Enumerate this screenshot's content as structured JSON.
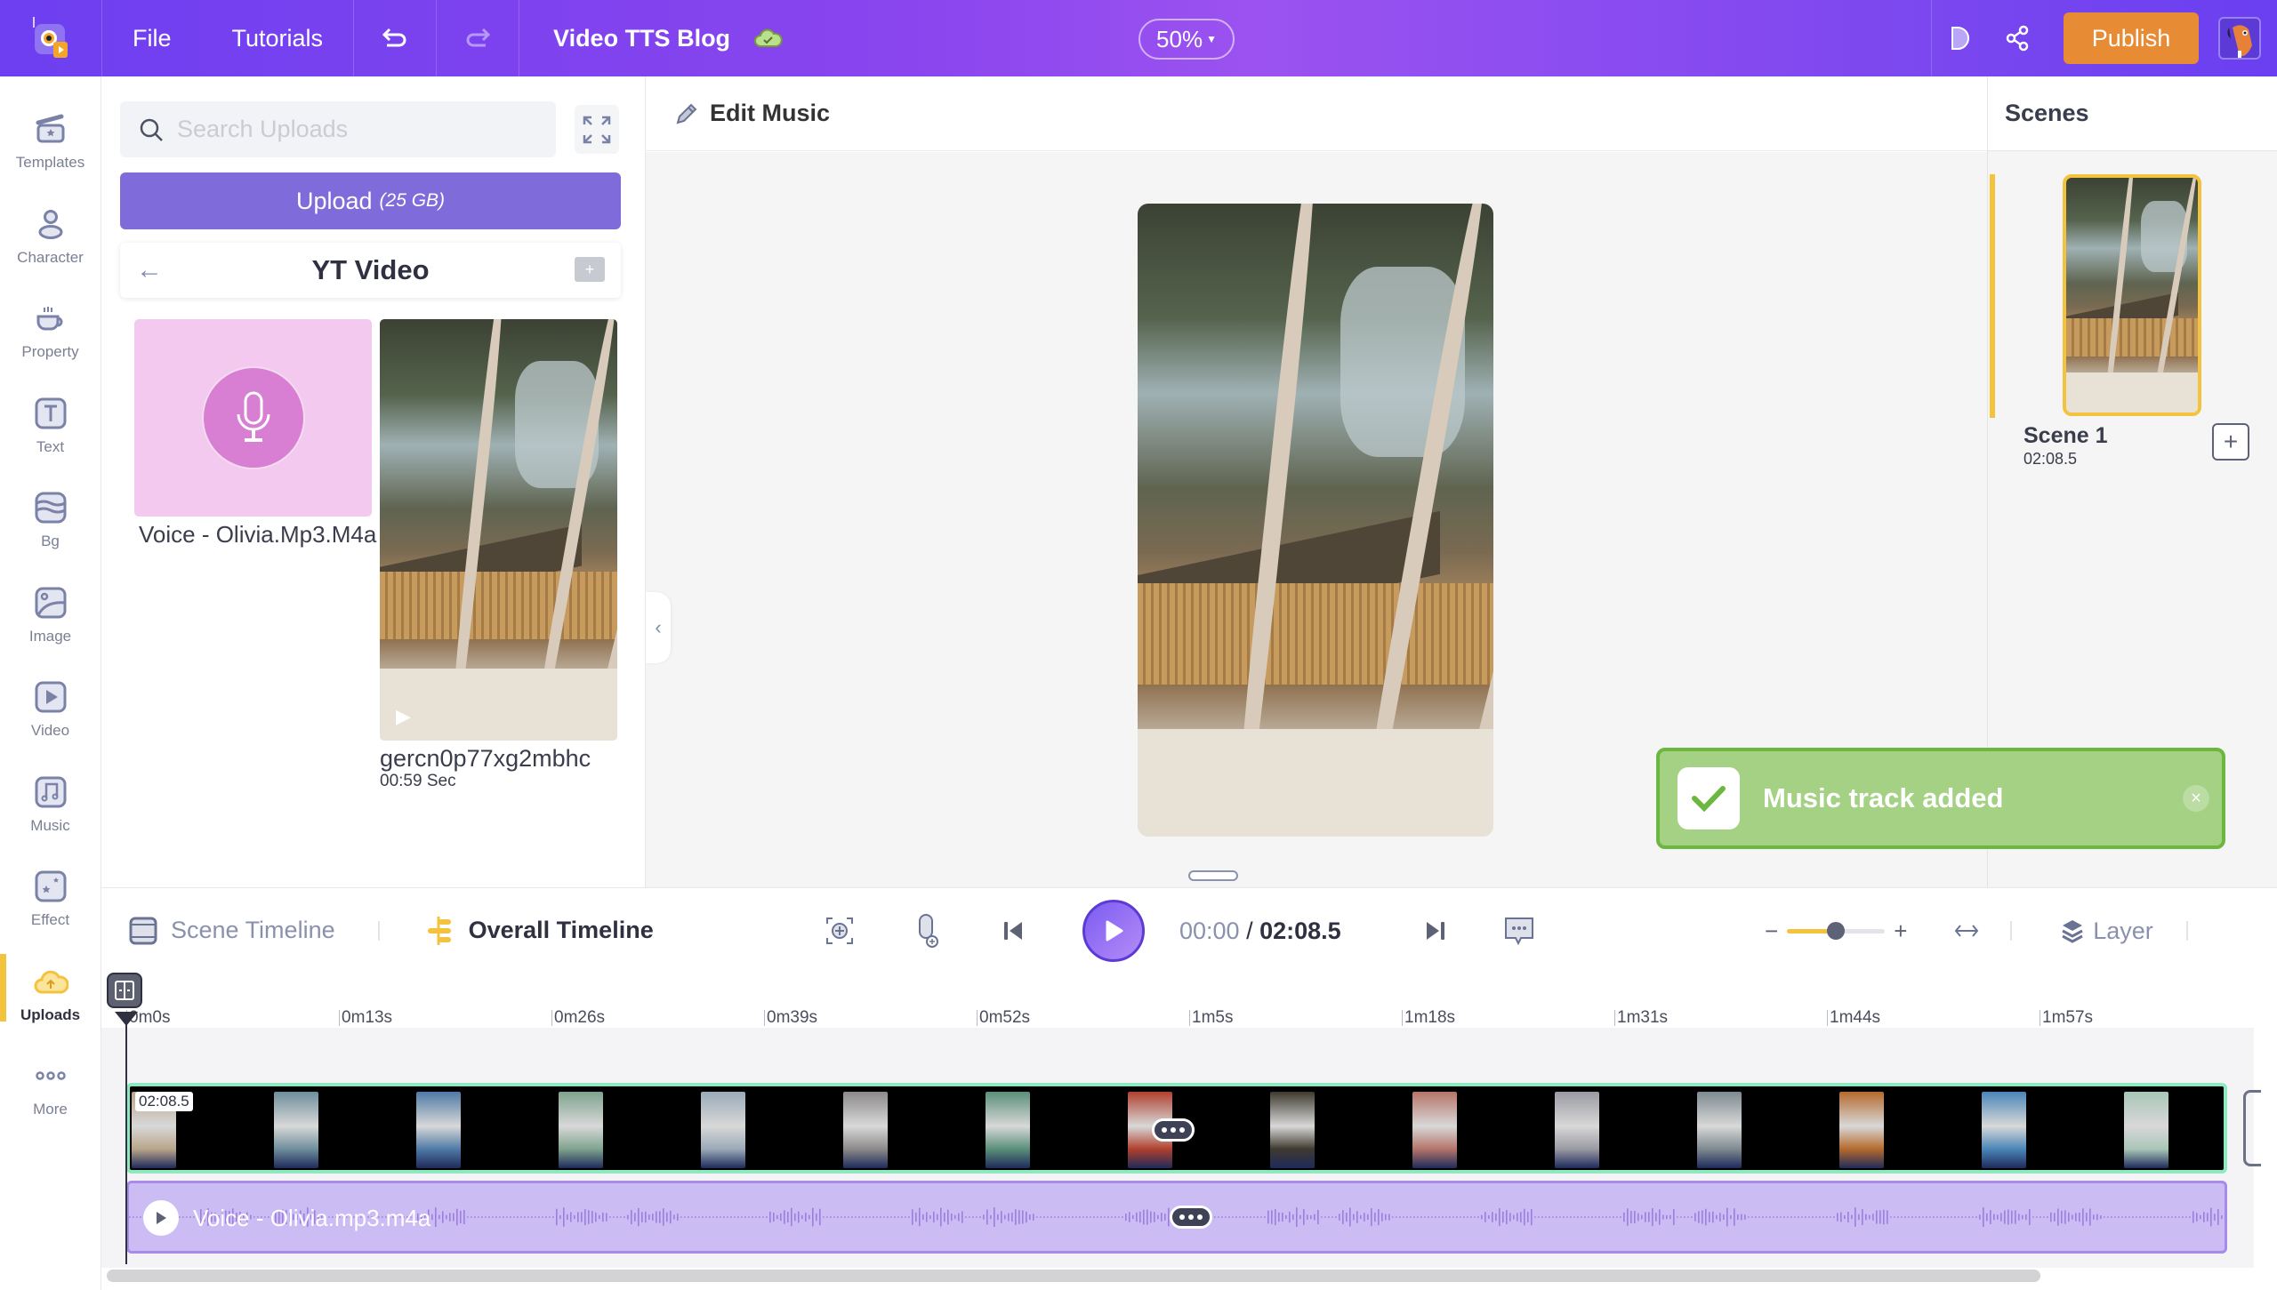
{
  "topbar": {
    "menu": [
      "File",
      "Tutorials"
    ],
    "project_title": "Video TTS Blog",
    "zoom_level": "50%",
    "publish_label": "Publish",
    "icons": {
      "logo": "app-logo",
      "undo": "undo-icon",
      "redo": "redo-icon",
      "cloud": "cloud-saved-icon",
      "preview": "play-preview-icon",
      "share": "share-icon"
    }
  },
  "sidebar": {
    "items": [
      {
        "label": "Templates",
        "icon": "clapperboard-icon",
        "active": false
      },
      {
        "label": "Character",
        "icon": "person-icon",
        "active": false
      },
      {
        "label": "Property",
        "icon": "cup-icon",
        "active": false
      },
      {
        "label": "Text",
        "icon": "text-icon",
        "active": false
      },
      {
        "label": "Bg",
        "icon": "layers-icon",
        "active": false
      },
      {
        "label": "Image",
        "icon": "image-icon",
        "active": false
      },
      {
        "label": "Video",
        "icon": "video-icon",
        "active": false
      },
      {
        "label": "Music",
        "icon": "music-note-icon",
        "active": false
      },
      {
        "label": "Effect",
        "icon": "sparkle-icon",
        "active": false
      },
      {
        "label": "Uploads",
        "icon": "cloud-upload-icon",
        "active": true
      },
      {
        "label": "More",
        "icon": "more-dots-icon",
        "active": false
      }
    ]
  },
  "uploads": {
    "search_placeholder": "Search Uploads",
    "search_value": "",
    "upload_label": "Upload",
    "upload_quota": "(25 GB)",
    "folder_title": "YT Video",
    "assets": [
      {
        "name": "Voice - Olivia.Mp3.M4a",
        "type": "audio"
      },
      {
        "name": "gercn0p77xg2mbhc",
        "duration": "00:59 Sec",
        "type": "video"
      }
    ]
  },
  "editor": {
    "header_label": "Edit Music"
  },
  "scenes": {
    "title": "Scenes",
    "items": [
      {
        "name": "Scene 1",
        "duration": "02:08.5"
      }
    ]
  },
  "toast": {
    "message": "Music track added",
    "status_color": "#6cb73f"
  },
  "timeline": {
    "tabs": [
      {
        "label": "Scene Timeline",
        "active": false
      },
      {
        "label": "Overall Timeline",
        "active": true
      }
    ],
    "current_time": "00:00",
    "separator": "/",
    "total_time": "02:08.5",
    "zoom_minus": "−",
    "zoom_plus": "+",
    "zoom_value": 0.5,
    "layer_label": "Layer",
    "ruler_ticks": [
      "0m0s",
      "0m13s",
      "0m26s",
      "0m39s",
      "0m52s",
      "1m5s",
      "1m18s",
      "1m31s",
      "1m44s",
      "1m57s"
    ],
    "video_track_duration": "02:08.5",
    "audio_track_label": "Voice - Olivia.mp3.m4a"
  },
  "colors": {
    "accent": "#7f6bd9",
    "publish": "#e88b35",
    "active_highlight": "#f3c33d",
    "video_track_border": "#8ee8c0",
    "audio_track": "#cbbdf3"
  }
}
